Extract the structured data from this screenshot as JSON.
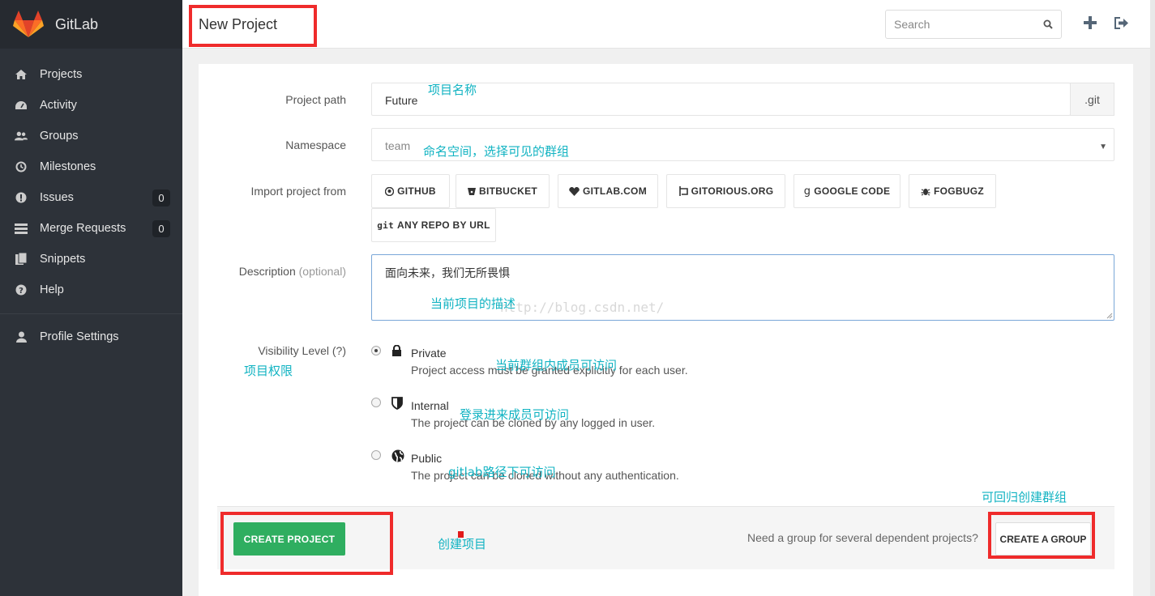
{
  "app": {
    "name": "GitLab"
  },
  "sidebar": {
    "items": [
      {
        "label": "Projects",
        "icon": "home-icon"
      },
      {
        "label": "Activity",
        "icon": "dashboard-icon"
      },
      {
        "label": "Groups",
        "icon": "users-icon"
      },
      {
        "label": "Milestones",
        "icon": "clock-icon"
      },
      {
        "label": "Issues",
        "icon": "exclamation-icon",
        "count": "0"
      },
      {
        "label": "Merge Requests",
        "icon": "list-icon",
        "count": "0"
      },
      {
        "label": "Snippets",
        "icon": "clipboard-icon"
      },
      {
        "label": "Help",
        "icon": "question-icon"
      }
    ],
    "profile": {
      "label": "Profile Settings",
      "icon": "user-icon"
    }
  },
  "header": {
    "title": "New Project",
    "search_placeholder": "Search"
  },
  "form": {
    "project_path": {
      "label": "Project path",
      "value": "Future",
      "suffix": ".git"
    },
    "namespace": {
      "label": "Namespace",
      "value": "team"
    },
    "import": {
      "label": "Import project from",
      "sources": [
        "GITHUB",
        "BITBUCKET",
        "GITLAB.COM",
        "GITORIOUS.ORG",
        "GOOGLE CODE",
        "FOGBUGZ",
        "ANY REPO BY URL"
      ],
      "git_prefix": "git"
    },
    "description": {
      "label": "Description",
      "optional": "(optional)",
      "value": "面向未来，我们无所畏惧"
    },
    "visibility": {
      "label": "Visibility Level (?)",
      "options": [
        {
          "name": "Private",
          "desc": "Project access must be granted explicitly for each user.",
          "selected": true
        },
        {
          "name": "Internal",
          "desc": "The project can be cloned by any logged in user.",
          "selected": false
        },
        {
          "name": "Public",
          "desc": "The project can be cloned without any authentication.",
          "selected": false
        }
      ]
    }
  },
  "footer": {
    "create_label": "CREATE PROJECT",
    "need_group_text": "Need a group for several dependent projects?",
    "create_group_label": "CREATE A GROUP"
  },
  "annotations": {
    "project_name": "项目名称",
    "namespace": "命名空间，选择可见的群组",
    "description": "当前项目的描述",
    "visibility": "项目权限",
    "private": "当前群组内成员可访问",
    "internal": "登录进来成员可访问",
    "public": "gitlab路径下可访问",
    "create_group": "可回归创建群组",
    "create_project": "创建项目"
  },
  "watermark": "http://blog.csdn.net/",
  "colors": {
    "sidebar": "#2d3239",
    "brand": "#262a30",
    "primary": "#2fae60",
    "annotation": "#11b3c2",
    "highlight": "#ef2b2b"
  }
}
